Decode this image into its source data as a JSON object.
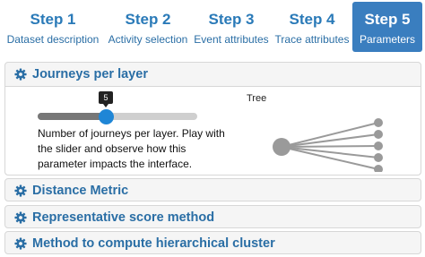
{
  "steps": [
    {
      "num": "Step 1",
      "label": "Dataset description"
    },
    {
      "num": "Step 2",
      "label": "Activity selection"
    },
    {
      "num": "Step 3",
      "label": "Event attributes"
    },
    {
      "num": "Step 4",
      "label": "Trace attributes"
    },
    {
      "num": "Step 5",
      "label": "Parameters",
      "active": true
    }
  ],
  "panels": {
    "journeys": {
      "title": "Journeys per layer",
      "slider_value": "5",
      "description": "Number of journeys per layer. Play with the slider and observe how this parameter impacts the interface.",
      "preview_label": "Tree"
    },
    "distance": {
      "title": "Distance Metric"
    },
    "representative": {
      "title": "Representative score method"
    },
    "hierarchical": {
      "title": "Method to compute hierarchical cluster"
    }
  },
  "colors": {
    "accent": "#2a6ea5",
    "active_step_bg": "#3a7ebf",
    "slider_handle": "#1f86d6",
    "tree_node": "#9a9a9a"
  },
  "icons": [
    "gear-icon"
  ]
}
